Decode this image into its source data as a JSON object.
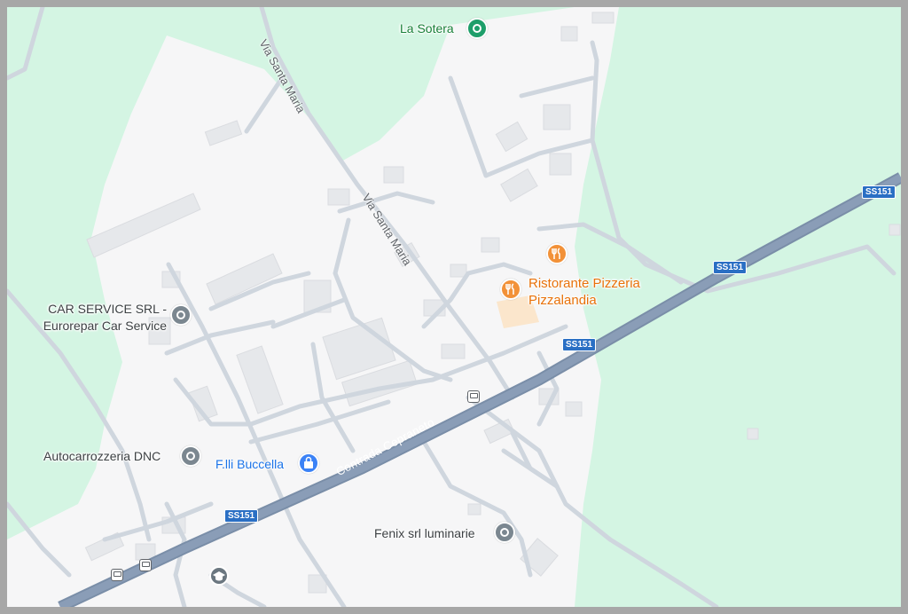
{
  "colors": {
    "greenspace": "#d4f5e3",
    "urban": "#f6f6f7",
    "minor_road": "#cfd6de",
    "highway": "#8a9db7",
    "highway_casing": "#7a8ea8",
    "building": "#e8eaed",
    "route_shield": "#2a6fc4"
  },
  "places": [
    {
      "key": "la_sotera",
      "name": "La Sotera",
      "icon": "green-place-icon"
    },
    {
      "key": "ristorante",
      "name": "Ristorante Pizzeria\nPizzalandia",
      "icon": "restaurant-icon"
    },
    {
      "key": "restaurant_small",
      "name": "",
      "icon": "restaurant-icon"
    },
    {
      "key": "car_service",
      "name": "CAR SERVICE SRL -\nEurorepar Car Service",
      "icon": "place-pin-icon"
    },
    {
      "key": "autocarrozzeria",
      "name": "Autocarrozzeria DNC",
      "icon": "place-pin-icon"
    },
    {
      "key": "buccella",
      "name": "F.lli Buccella",
      "icon": "shopping-bag-icon"
    },
    {
      "key": "fenix",
      "name": "Fenix srl luminarie",
      "icon": "place-pin-icon"
    }
  ],
  "roads": {
    "via_santa_maria_1": "Via Santa Maria",
    "via_santa_maria_2": "Via Santa Maria",
    "contrada_cepraneto": "Contrada Cepraneto"
  },
  "route_shields": [
    "SS151",
    "SS151",
    "SS151",
    "SS151"
  ],
  "transit_stops": 4,
  "icons": {
    "school": "school-icon",
    "transit": "bus-stop-icon"
  }
}
